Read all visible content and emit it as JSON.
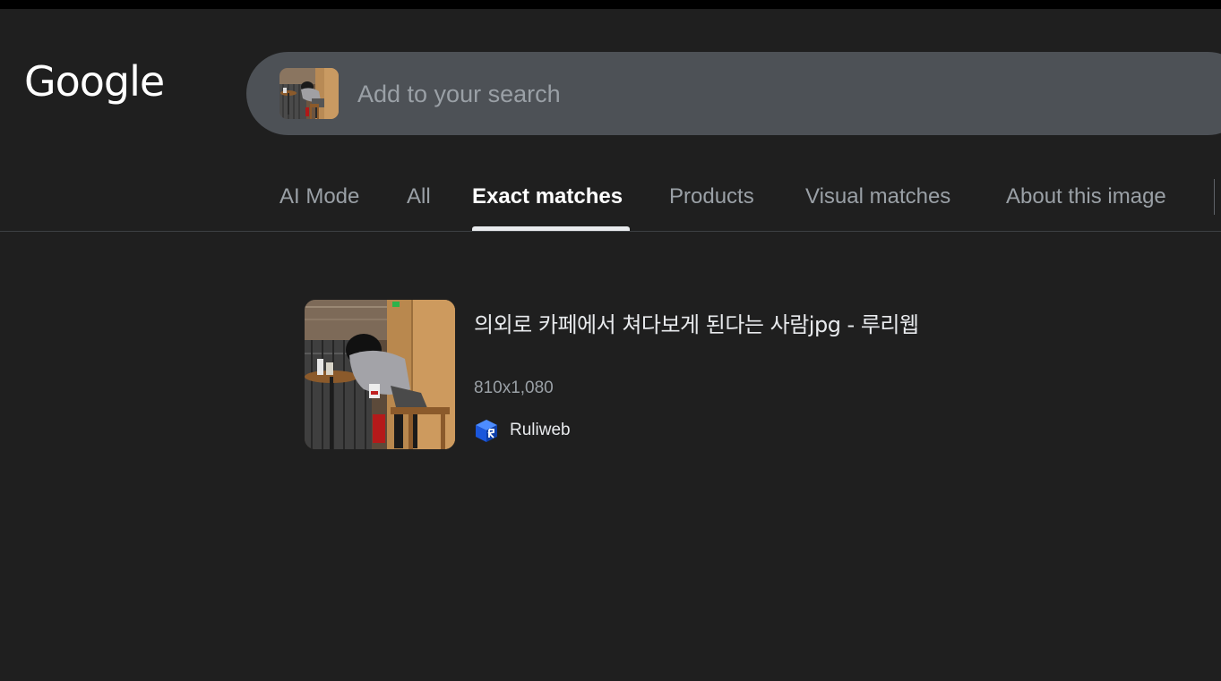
{
  "header": {
    "logo_text": "Google",
    "search": {
      "placeholder": "Add to your search",
      "value": ""
    }
  },
  "tabs": [
    {
      "label": "AI Mode",
      "active": false
    },
    {
      "label": "All",
      "active": false
    },
    {
      "label": "Exact matches",
      "active": true
    },
    {
      "label": "Products",
      "active": false
    },
    {
      "label": "Visual matches",
      "active": false
    },
    {
      "label": "About this image",
      "active": false
    }
  ],
  "result": {
    "title": "의외로 카페에서 쳐다보게 된다는 사람jpg - 루리웹",
    "dimensions": "810x1,080",
    "source": {
      "name": "Ruliweb",
      "icon": "ruliweb-cube-icon"
    }
  },
  "colors": {
    "background": "#1f1f1f",
    "search_box": "#4d5156",
    "active_tab": "#ffffff",
    "inactive_tab": "#9aa0a6",
    "source_icon": "#1a56db"
  }
}
